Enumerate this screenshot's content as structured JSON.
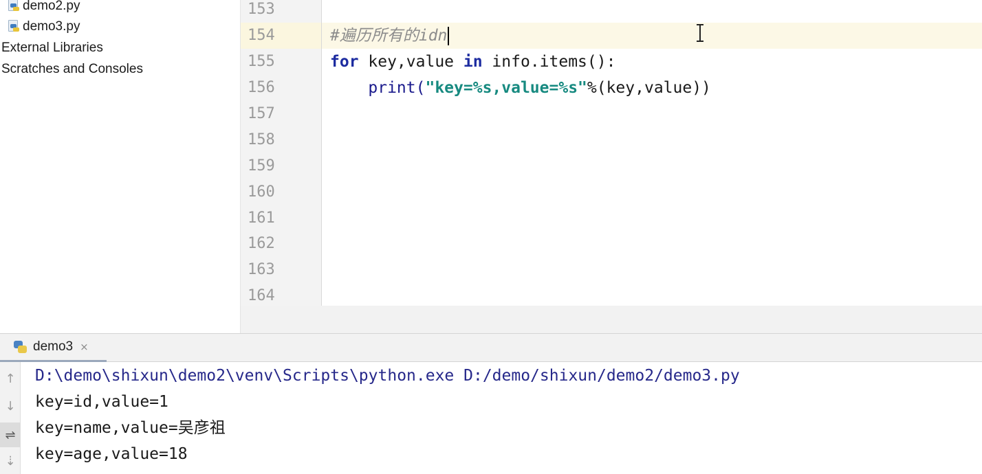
{
  "project_tree": {
    "items": [
      {
        "label": "demo2.py",
        "icon": "python-file-icon"
      },
      {
        "label": "demo3.py",
        "icon": "python-file-icon"
      },
      {
        "label": "External Libraries"
      },
      {
        "label": "Scratches and Consoles"
      }
    ]
  },
  "editor": {
    "line_numbers": [
      "153",
      "154",
      "155",
      "156",
      "157",
      "158",
      "159",
      "160",
      "161",
      "162",
      "163",
      "164"
    ],
    "current_line": "154",
    "code": {
      "comment": "#遍历所有的idn",
      "for_kw": "for",
      "for_vars": " key,value ",
      "in_kw": "in",
      "for_iter": " info.items():",
      "indent": "    ",
      "print_fn": "print(",
      "print_str": "\"key=%s,value=%s\"",
      "print_rest": "%(key,value))"
    }
  },
  "run_panel": {
    "tab_label": "demo3",
    "tab_close": "×",
    "tool_icons": {
      "up": "↑",
      "down": "↓",
      "wrap": "⇌",
      "scroll_end": "⇣"
    },
    "output": {
      "command": "D:\\demo\\shixun\\demo2\\venv\\Scripts\\python.exe D:/demo/shixun/demo2/demo3.py",
      "lines": [
        "key=id,value=1",
        "key=name,value=吴彦祖",
        "key=age,value=18"
      ]
    }
  },
  "colors": {
    "keyword": "#1d2ca0",
    "string": "#178a80",
    "comment": "#8c8c8c",
    "current_line_bg": "#fcf8e6",
    "command_text": "#26288a"
  }
}
